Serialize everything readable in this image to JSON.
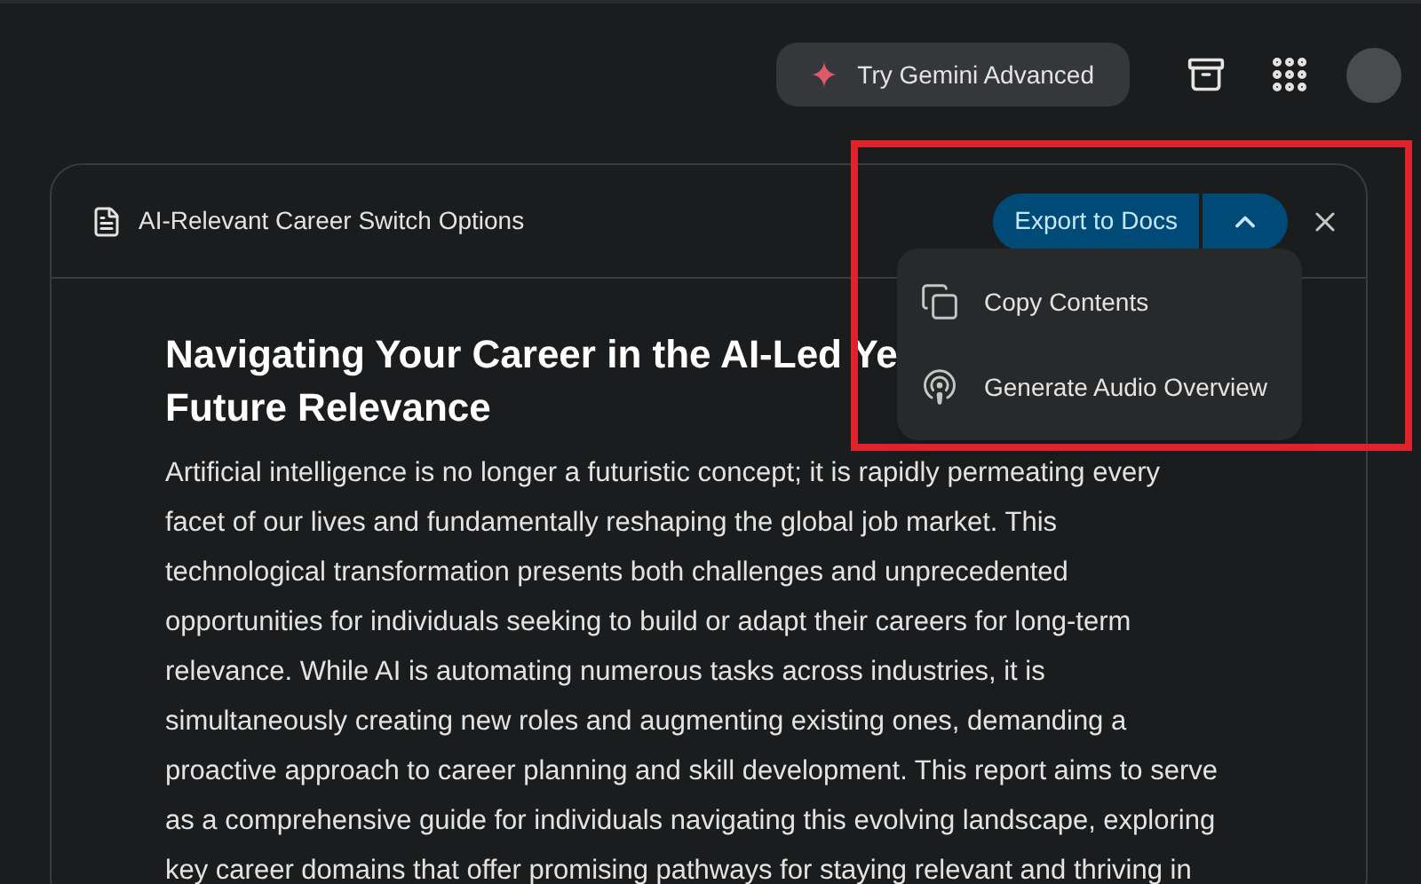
{
  "top_bar": {
    "upgrade_button": "Try Gemini Advanced"
  },
  "document": {
    "title": "AI-Relevant Career Switch Options",
    "export_button": "Export to Docs",
    "menu_expanded": true,
    "menu": [
      {
        "kind": "copy",
        "label": "Copy Contents"
      },
      {
        "kind": "audio",
        "label": "Generate Audio Overview"
      }
    ],
    "heading_lines": [
      "Navigating Your Career in the AI-Led Ye",
      "Future Relevance"
    ],
    "paragraph_lines": [
      "Artificial intelligence is no longer a futuristic concept; it is rapidly permeating every",
      "facet of our lives and fundamentally reshaping the global job market. This",
      "technological transformation presents both challenges and unprecedented",
      "opportunities for individuals seeking to build or adapt their careers for long-term",
      "relevance. While AI is automating numerous tasks across industries, it is",
      "simultaneously creating new roles and augmenting existing ones, demanding a",
      "proactive approach to career planning and skill development. This report aims to serve",
      "as a comprehensive guide for individuals navigating this evolving landscape, exploring",
      "key career domains that offer promising pathways for staying relevant and thriving in"
    ]
  }
}
